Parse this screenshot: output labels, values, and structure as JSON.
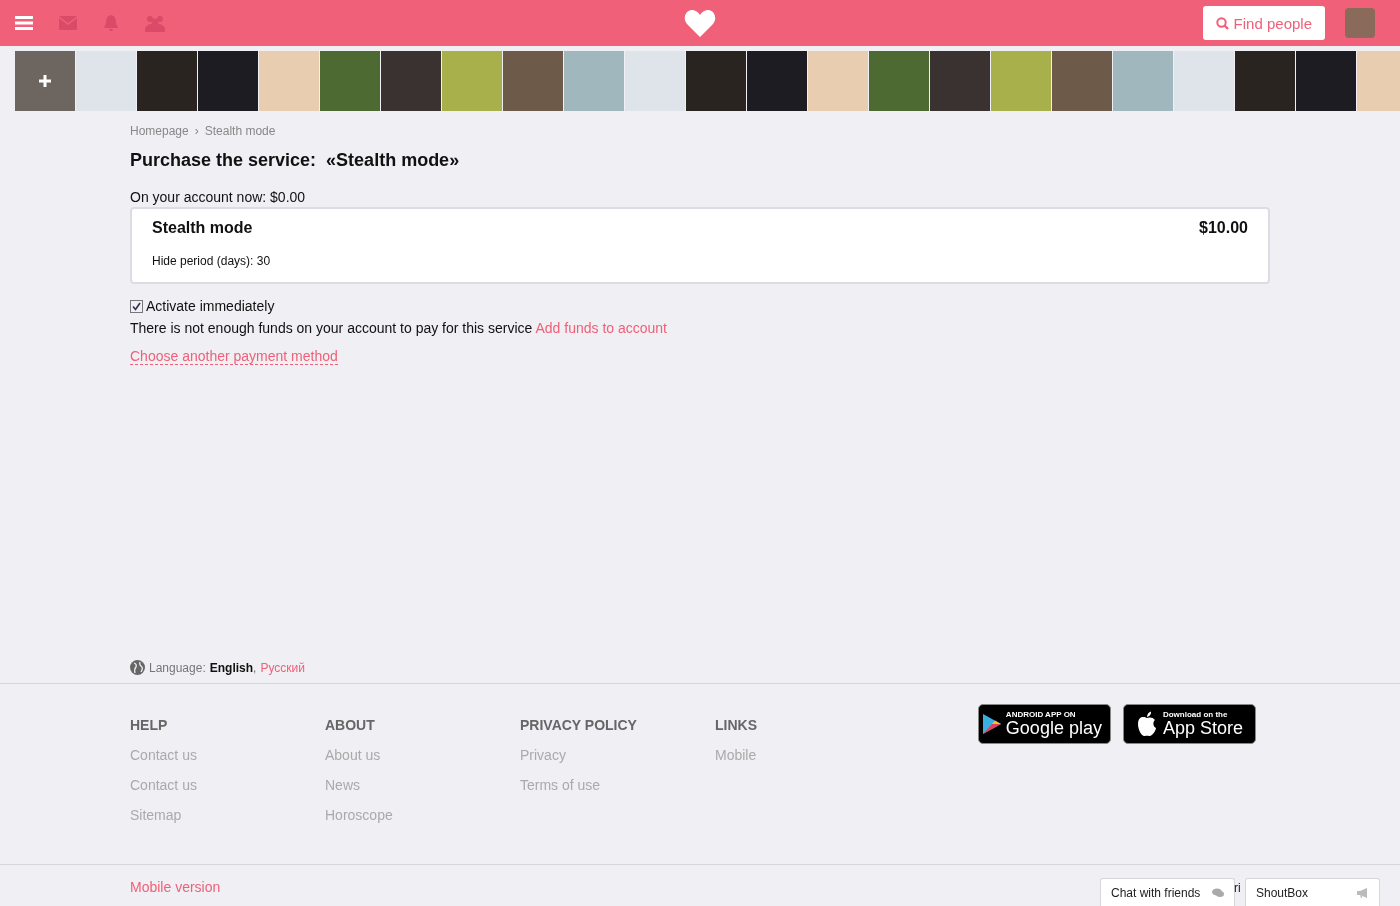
{
  "header": {
    "search_button": "Find people"
  },
  "photo_strip": [
    {
      "kind": "add"
    },
    {
      "kind": "photo"
    },
    {
      "kind": "photo"
    },
    {
      "kind": "photo"
    },
    {
      "kind": "photo"
    },
    {
      "kind": "photo"
    },
    {
      "kind": "photo"
    },
    {
      "kind": "photo"
    },
    {
      "kind": "photo"
    },
    {
      "kind": "photo"
    },
    {
      "kind": "photo"
    },
    {
      "kind": "photo"
    },
    {
      "kind": "photo"
    },
    {
      "kind": "photo"
    },
    {
      "kind": "photo"
    },
    {
      "kind": "photo"
    },
    {
      "kind": "photo"
    },
    {
      "kind": "photo"
    },
    {
      "kind": "photo"
    },
    {
      "kind": "photo"
    },
    {
      "kind": "photo"
    },
    {
      "kind": "photo"
    },
    {
      "kind": "photo"
    }
  ],
  "breadcrumbs": [
    "Homepage",
    "Stealth mode"
  ],
  "breadcrumb_separator": "›",
  "title": "Purchase the service:  «Stealth mode»",
  "balance": "On your account now: $0.00",
  "service": {
    "name": "Stealth mode",
    "price": "$10.00",
    "detail": "Hide period (days): 30"
  },
  "activate": {
    "label": "Activate immediately",
    "checked": true
  },
  "notice": {
    "text": "There is not enough funds on your account to pay for this service",
    "link": "Add funds to account"
  },
  "other_payment": "Choose another payment method",
  "language": {
    "label": "Language:",
    "items": [
      {
        "name": "English",
        "selected": true
      },
      {
        "name": "Русский",
        "selected": false
      }
    ],
    "separator": ","
  },
  "footer_columns": [
    {
      "heading": "HELP",
      "links": [
        "Contact us",
        "Contact us",
        "Sitemap"
      ]
    },
    {
      "heading": "ABOUT",
      "links": [
        "About us",
        "News",
        "Horoscope"
      ]
    },
    {
      "heading": "PRIVACY POLICY",
      "links": [
        "Privacy",
        "Terms of use"
      ]
    },
    {
      "heading": "LINKS",
      "links": [
        "Mobile"
      ]
    }
  ],
  "store_badges": [
    {
      "kind": "google",
      "small": "ANDROID APP ON",
      "big": "Google play"
    },
    {
      "kind": "apple",
      "small": "Download on the",
      "big": "App Store"
    }
  ],
  "mobile_version": "Mobile version",
  "hidden_text_fragment": "ri",
  "chat_tabs": [
    {
      "kind": "chat",
      "label": "Chat with friends"
    },
    {
      "kind": "shout",
      "label": "ShoutBox"
    }
  ]
}
